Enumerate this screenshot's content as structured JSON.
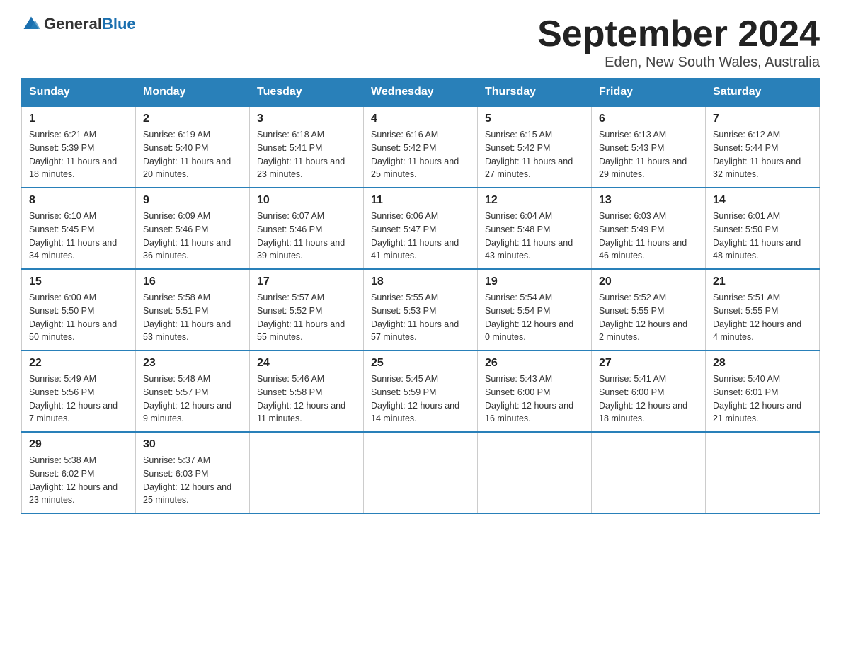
{
  "header": {
    "logo_general": "General",
    "logo_blue": "Blue",
    "month_title": "September 2024",
    "location": "Eden, New South Wales, Australia"
  },
  "weekdays": [
    "Sunday",
    "Monday",
    "Tuesday",
    "Wednesday",
    "Thursday",
    "Friday",
    "Saturday"
  ],
  "weeks": [
    [
      {
        "day": "1",
        "sunrise": "6:21 AM",
        "sunset": "5:39 PM",
        "daylight": "11 hours and 18 minutes."
      },
      {
        "day": "2",
        "sunrise": "6:19 AM",
        "sunset": "5:40 PM",
        "daylight": "11 hours and 20 minutes."
      },
      {
        "day": "3",
        "sunrise": "6:18 AM",
        "sunset": "5:41 PM",
        "daylight": "11 hours and 23 minutes."
      },
      {
        "day": "4",
        "sunrise": "6:16 AM",
        "sunset": "5:42 PM",
        "daylight": "11 hours and 25 minutes."
      },
      {
        "day": "5",
        "sunrise": "6:15 AM",
        "sunset": "5:42 PM",
        "daylight": "11 hours and 27 minutes."
      },
      {
        "day": "6",
        "sunrise": "6:13 AM",
        "sunset": "5:43 PM",
        "daylight": "11 hours and 29 minutes."
      },
      {
        "day": "7",
        "sunrise": "6:12 AM",
        "sunset": "5:44 PM",
        "daylight": "11 hours and 32 minutes."
      }
    ],
    [
      {
        "day": "8",
        "sunrise": "6:10 AM",
        "sunset": "5:45 PM",
        "daylight": "11 hours and 34 minutes."
      },
      {
        "day": "9",
        "sunrise": "6:09 AM",
        "sunset": "5:46 PM",
        "daylight": "11 hours and 36 minutes."
      },
      {
        "day": "10",
        "sunrise": "6:07 AM",
        "sunset": "5:46 PM",
        "daylight": "11 hours and 39 minutes."
      },
      {
        "day": "11",
        "sunrise": "6:06 AM",
        "sunset": "5:47 PM",
        "daylight": "11 hours and 41 minutes."
      },
      {
        "day": "12",
        "sunrise": "6:04 AM",
        "sunset": "5:48 PM",
        "daylight": "11 hours and 43 minutes."
      },
      {
        "day": "13",
        "sunrise": "6:03 AM",
        "sunset": "5:49 PM",
        "daylight": "11 hours and 46 minutes."
      },
      {
        "day": "14",
        "sunrise": "6:01 AM",
        "sunset": "5:50 PM",
        "daylight": "11 hours and 48 minutes."
      }
    ],
    [
      {
        "day": "15",
        "sunrise": "6:00 AM",
        "sunset": "5:50 PM",
        "daylight": "11 hours and 50 minutes."
      },
      {
        "day": "16",
        "sunrise": "5:58 AM",
        "sunset": "5:51 PM",
        "daylight": "11 hours and 53 minutes."
      },
      {
        "day": "17",
        "sunrise": "5:57 AM",
        "sunset": "5:52 PM",
        "daylight": "11 hours and 55 minutes."
      },
      {
        "day": "18",
        "sunrise": "5:55 AM",
        "sunset": "5:53 PM",
        "daylight": "11 hours and 57 minutes."
      },
      {
        "day": "19",
        "sunrise": "5:54 AM",
        "sunset": "5:54 PM",
        "daylight": "12 hours and 0 minutes."
      },
      {
        "day": "20",
        "sunrise": "5:52 AM",
        "sunset": "5:55 PM",
        "daylight": "12 hours and 2 minutes."
      },
      {
        "day": "21",
        "sunrise": "5:51 AM",
        "sunset": "5:55 PM",
        "daylight": "12 hours and 4 minutes."
      }
    ],
    [
      {
        "day": "22",
        "sunrise": "5:49 AM",
        "sunset": "5:56 PM",
        "daylight": "12 hours and 7 minutes."
      },
      {
        "day": "23",
        "sunrise": "5:48 AM",
        "sunset": "5:57 PM",
        "daylight": "12 hours and 9 minutes."
      },
      {
        "day": "24",
        "sunrise": "5:46 AM",
        "sunset": "5:58 PM",
        "daylight": "12 hours and 11 minutes."
      },
      {
        "day": "25",
        "sunrise": "5:45 AM",
        "sunset": "5:59 PM",
        "daylight": "12 hours and 14 minutes."
      },
      {
        "day": "26",
        "sunrise": "5:43 AM",
        "sunset": "6:00 PM",
        "daylight": "12 hours and 16 minutes."
      },
      {
        "day": "27",
        "sunrise": "5:41 AM",
        "sunset": "6:00 PM",
        "daylight": "12 hours and 18 minutes."
      },
      {
        "day": "28",
        "sunrise": "5:40 AM",
        "sunset": "6:01 PM",
        "daylight": "12 hours and 21 minutes."
      }
    ],
    [
      {
        "day": "29",
        "sunrise": "5:38 AM",
        "sunset": "6:02 PM",
        "daylight": "12 hours and 23 minutes."
      },
      {
        "day": "30",
        "sunrise": "5:37 AM",
        "sunset": "6:03 PM",
        "daylight": "12 hours and 25 minutes."
      },
      null,
      null,
      null,
      null,
      null
    ]
  ],
  "labels": {
    "sunrise": "Sunrise:",
    "sunset": "Sunset:",
    "daylight": "Daylight:"
  }
}
